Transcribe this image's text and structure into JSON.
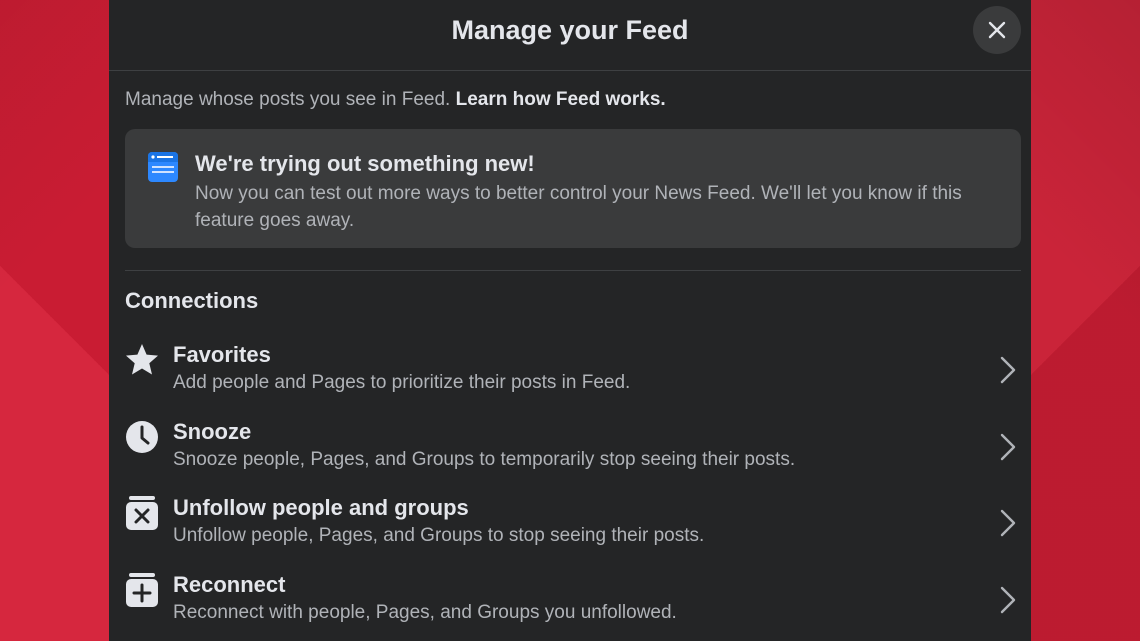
{
  "dialog": {
    "title": "Manage your Feed",
    "close_label": "Close"
  },
  "intro": {
    "text": "Manage whose posts you see in Feed.",
    "link": "Learn how Feed works."
  },
  "notice": {
    "icon": "news-feed-icon",
    "title": "We're trying out something new!",
    "body": "Now you can test out more ways to better control your News Feed. We'll let you know if this feature goes away."
  },
  "connections": {
    "section_title": "Connections",
    "items": [
      {
        "icon": "star-icon",
        "title": "Favorites",
        "description": "Add people and Pages to prioritize their posts in Feed."
      },
      {
        "icon": "clock-icon",
        "title": "Snooze",
        "description": "Snooze people, Pages, and Groups to temporarily stop seeing their posts."
      },
      {
        "icon": "unfollow-box-icon",
        "title": "Unfollow people and groups",
        "description": "Unfollow people, Pages, and Groups to stop seeing their posts."
      },
      {
        "icon": "reconnect-box-icon",
        "title": "Reconnect",
        "description": "Reconnect with people, Pages, and Groups you unfollowed."
      }
    ]
  },
  "colors": {
    "background_red": "#d21f35",
    "modal_bg": "#242526",
    "card_bg": "#3a3b3c",
    "primary_text": "#e4e6eb",
    "secondary_text": "#b0b3b8",
    "accent_blue": "#2d88ff"
  }
}
